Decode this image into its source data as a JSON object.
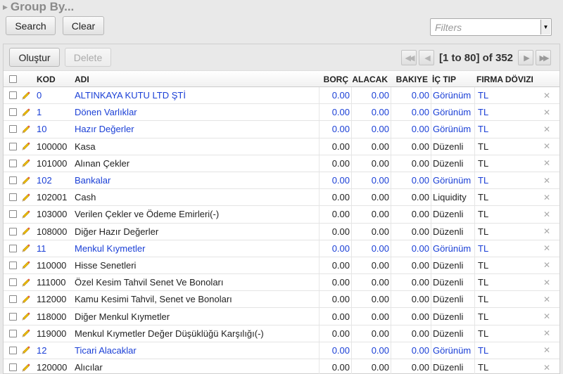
{
  "group_by": {
    "title": "Group By..."
  },
  "actions": {
    "search_label": "Search",
    "clear_label": "Clear"
  },
  "filters": {
    "placeholder": "Filters"
  },
  "toolbar": {
    "create_label": "Oluştur",
    "delete_label": "Delete"
  },
  "pager": {
    "info": "[1 to 80] of 352"
  },
  "columns": {
    "code": "KOD",
    "name": "ADI",
    "debit": "BORÇ",
    "credit": "ALACAK",
    "balance": "BAKIYE",
    "inner_type": "İÇ TIP",
    "currency": "FIRMA DÖVIZI"
  },
  "rows": [
    {
      "code": "0",
      "name": "ALTINKAYA KUTU LTD ŞTİ",
      "debit": "0.00",
      "credit": "0.00",
      "balance": "0.00",
      "type": "Görünüm",
      "currency": "TL",
      "view": true
    },
    {
      "code": "1",
      "name": "Dönen Varlıklar",
      "debit": "0.00",
      "credit": "0.00",
      "balance": "0.00",
      "type": "Görünüm",
      "currency": "TL",
      "view": true
    },
    {
      "code": "10",
      "name": "Hazır Değerler",
      "debit": "0.00",
      "credit": "0.00",
      "balance": "0.00",
      "type": "Görünüm",
      "currency": "TL",
      "view": true
    },
    {
      "code": "100000",
      "name": "Kasa",
      "debit": "0.00",
      "credit": "0.00",
      "balance": "0.00",
      "type": "Düzenli",
      "currency": "TL",
      "view": false
    },
    {
      "code": "101000",
      "name": "Alınan Çekler",
      "debit": "0.00",
      "credit": "0.00",
      "balance": "0.00",
      "type": "Düzenli",
      "currency": "TL",
      "view": false
    },
    {
      "code": "102",
      "name": "Bankalar",
      "debit": "0.00",
      "credit": "0.00",
      "balance": "0.00",
      "type": "Görünüm",
      "currency": "TL",
      "view": true
    },
    {
      "code": "102001",
      "name": "Cash",
      "debit": "0.00",
      "credit": "0.00",
      "balance": "0.00",
      "type": "Liquidity",
      "currency": "TL",
      "view": false
    },
    {
      "code": "103000",
      "name": "Verilen Çekler ve Ödeme Emirleri(-)",
      "debit": "0.00",
      "credit": "0.00",
      "balance": "0.00",
      "type": "Düzenli",
      "currency": "TL",
      "view": false
    },
    {
      "code": "108000",
      "name": "Diğer Hazır Değerler",
      "debit": "0.00",
      "credit": "0.00",
      "balance": "0.00",
      "type": "Düzenli",
      "currency": "TL",
      "view": false
    },
    {
      "code": "11",
      "name": "Menkul Kıymetler",
      "debit": "0.00",
      "credit": "0.00",
      "balance": "0.00",
      "type": "Görünüm",
      "currency": "TL",
      "view": true
    },
    {
      "code": "110000",
      "name": "Hisse Senetleri",
      "debit": "0.00",
      "credit": "0.00",
      "balance": "0.00",
      "type": "Düzenli",
      "currency": "TL",
      "view": false
    },
    {
      "code": "111000",
      "name": "Özel Kesim Tahvil Senet Ve Bonoları",
      "debit": "0.00",
      "credit": "0.00",
      "balance": "0.00",
      "type": "Düzenli",
      "currency": "TL",
      "view": false
    },
    {
      "code": "112000",
      "name": "Kamu Kesimi Tahvil, Senet ve Bonoları",
      "debit": "0.00",
      "credit": "0.00",
      "balance": "0.00",
      "type": "Düzenli",
      "currency": "TL",
      "view": false
    },
    {
      "code": "118000",
      "name": "Diğer Menkul Kıymetler",
      "debit": "0.00",
      "credit": "0.00",
      "balance": "0.00",
      "type": "Düzenli",
      "currency": "TL",
      "view": false
    },
    {
      "code": "119000",
      "name": "Menkul Kıymetler Değer Düşüklüğü Karşılığı(-)",
      "debit": "0.00",
      "credit": "0.00",
      "balance": "0.00",
      "type": "Düzenli",
      "currency": "TL",
      "view": false
    },
    {
      "code": "12",
      "name": "Ticari Alacaklar",
      "debit": "0.00",
      "credit": "0.00",
      "balance": "0.00",
      "type": "Görünüm",
      "currency": "TL",
      "view": true
    },
    {
      "code": "120000",
      "name": "Alıcılar",
      "debit": "0.00",
      "credit": "0.00",
      "balance": "0.00",
      "type": "Düzenli",
      "currency": "TL",
      "view": false
    }
  ],
  "colors": {
    "view_row_text": "#1a3fd6",
    "normal_text": "#222222"
  },
  "icons": {
    "edit": "pencil-icon",
    "remove": "close-icon",
    "first": "first-page-icon",
    "prev": "prev-page-icon",
    "next": "next-page-icon",
    "last": "last-page-icon"
  }
}
